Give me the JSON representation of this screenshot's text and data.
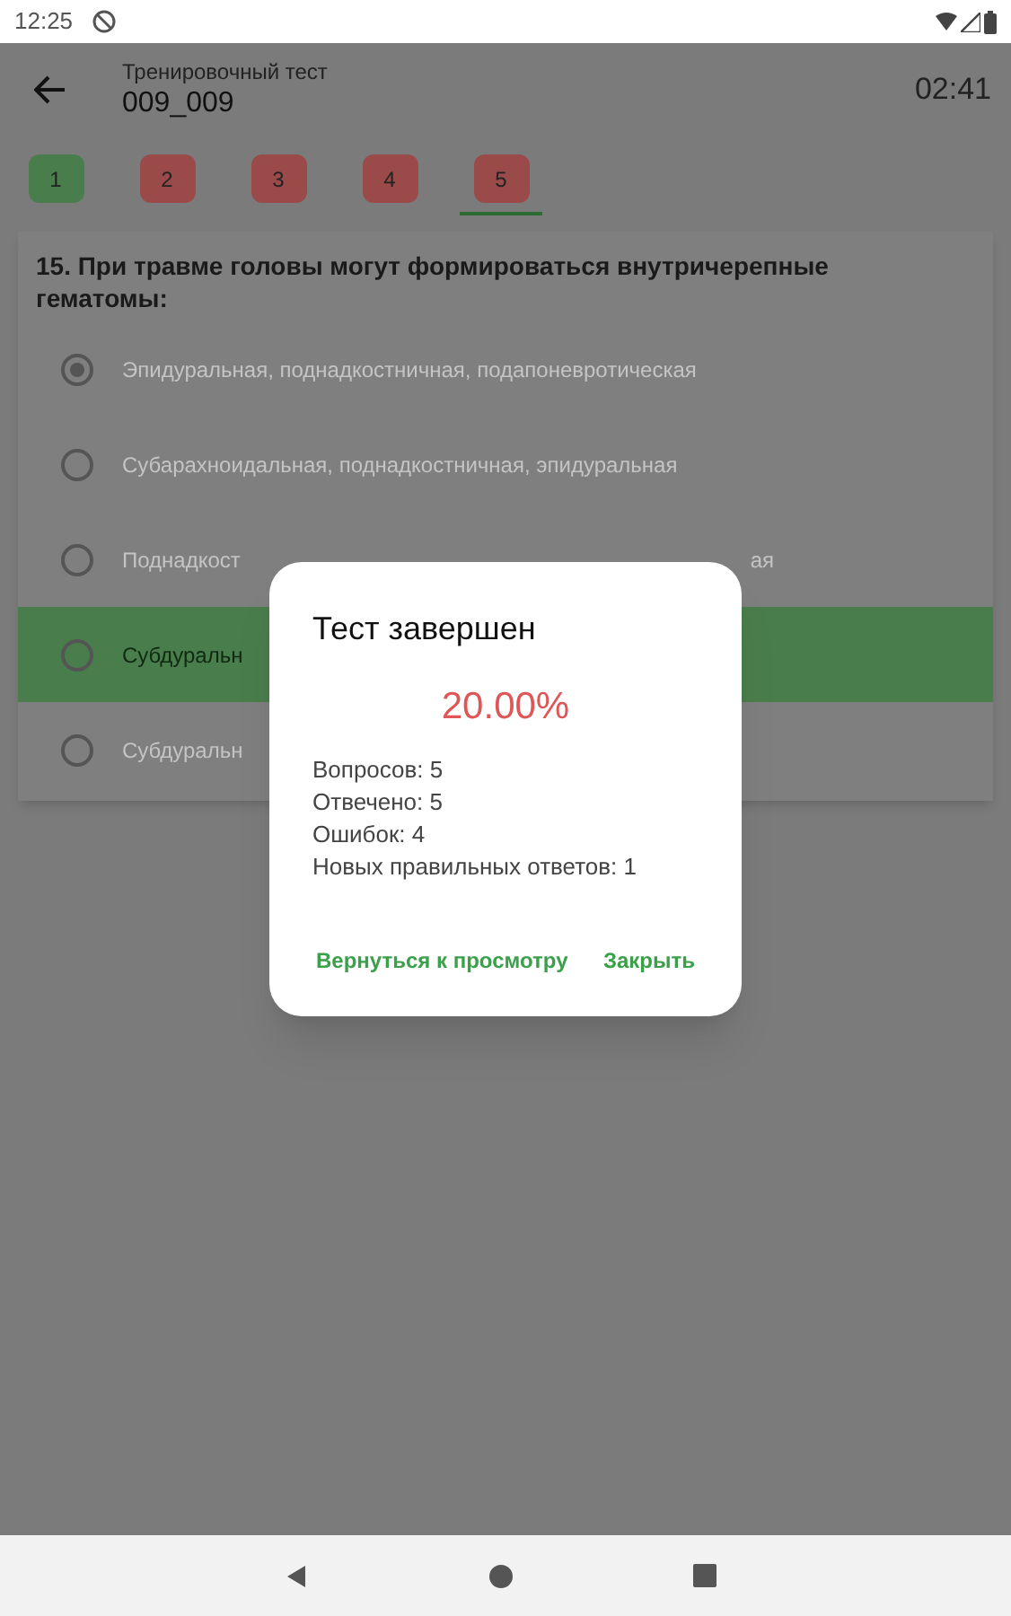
{
  "status_bar": {
    "time": "12:25"
  },
  "header": {
    "subtitle": "Тренировочный тест",
    "title": "009_009",
    "timer": "02:41"
  },
  "question_tabs": [
    {
      "label": "1",
      "color": "#4a7d4c",
      "selected": false
    },
    {
      "label": "2",
      "color": "#9b4a4a",
      "selected": false
    },
    {
      "label": "3",
      "color": "#9b4a4a",
      "selected": false
    },
    {
      "label": "4",
      "color": "#9b4a4a",
      "selected": false
    },
    {
      "label": "5",
      "color": "#9b4a4a",
      "selected": true
    }
  ],
  "question": {
    "text": "15. При травме головы могут формироваться внутричерепные гематомы:",
    "options": [
      {
        "text": "Эпидуральная, поднадкостничная, подапоневротическая",
        "checked": true,
        "correct": false
      },
      {
        "text": "Субарахноидальная, поднадкостничная, эпидуральная",
        "checked": false,
        "correct": false
      },
      {
        "text": "Поднадкост",
        "tail": "ая",
        "checked": false,
        "correct": false
      },
      {
        "text": "Субдуральн",
        "checked": false,
        "correct": true
      },
      {
        "text": "Субдуральн",
        "checked": false,
        "correct": false
      }
    ]
  },
  "dialog": {
    "title": "Тест завершен",
    "score": "20.00%",
    "stats": [
      "Вопросов: 5",
      "Отвечено: 5",
      "Ошибок: 4",
      "Новых правильных ответов: 1"
    ],
    "buttons": [
      "Вернуться к просмотру",
      "Закрыть"
    ]
  }
}
